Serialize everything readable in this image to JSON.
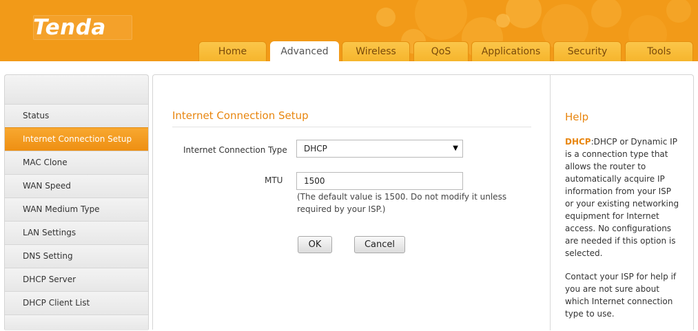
{
  "brand": {
    "logo_text": "Tenda"
  },
  "nav": {
    "tabs": [
      {
        "label": "Home"
      },
      {
        "label": "Advanced"
      },
      {
        "label": "Wireless"
      },
      {
        "label": "QoS"
      },
      {
        "label": "Applications"
      },
      {
        "label": "Security"
      },
      {
        "label": "Tools"
      }
    ],
    "active_tab": "Advanced"
  },
  "sidebar": {
    "items": [
      {
        "label": "Status"
      },
      {
        "label": "Internet Connection Setup"
      },
      {
        "label": "MAC Clone"
      },
      {
        "label": "WAN Speed"
      },
      {
        "label": "WAN Medium Type"
      },
      {
        "label": "LAN Settings"
      },
      {
        "label": "DNS Setting"
      },
      {
        "label": "DHCP Server"
      },
      {
        "label": "DHCP Client List"
      }
    ],
    "active_item": "Internet Connection Setup"
  },
  "form": {
    "title": "Internet Connection Setup",
    "connection_type_label": "Internet Connection Type",
    "connection_type_value": "DHCP",
    "mtu_label": "MTU",
    "mtu_value": "1500",
    "mtu_hint": "(The default value is 1500. Do not modify it unless required by your ISP.)",
    "ok_label": "OK",
    "cancel_label": "Cancel"
  },
  "help": {
    "title": "Help",
    "keyword": "DHCP",
    "paragraph1_rest": ":DHCP or Dynamic IP is a connection type that allows the router to automatically acquire IP information from your ISP or your existing networking equipment for Internet access. No configurations are needed if this option is selected.",
    "paragraph2": "Contact your ISP for help if you are not sure about which Internet connection type to use."
  },
  "colors": {
    "header_orange": "#f29a18",
    "accent_orange": "#e8860f",
    "tab_yellow": "#f8bd3c",
    "sidebar_active": "#f29a18"
  }
}
